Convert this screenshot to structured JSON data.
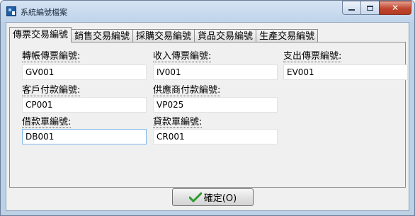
{
  "window": {
    "title": "系統編號檔案"
  },
  "tabs": [
    {
      "label": "傳票交易編號",
      "active": true
    },
    {
      "label": "銷售交易編號",
      "active": false
    },
    {
      "label": "採購交易編號",
      "active": false
    },
    {
      "label": "貨品交易編號",
      "active": false
    },
    {
      "label": "生產交易編號",
      "active": false
    }
  ],
  "fields": {
    "transfer_voucher": {
      "label": "轉帳傳票編號:",
      "value": "GV001"
    },
    "income_voucher": {
      "label": "收入傳票編號:",
      "value": "IV001"
    },
    "expense_voucher": {
      "label": "支出傳票編號:",
      "value": "EV001"
    },
    "customer_payment": {
      "label": "客戶付款編號:",
      "value": "CP001"
    },
    "supplier_payment": {
      "label": "供應商付款編號:",
      "value": "VP025"
    },
    "debit_note": {
      "label": "借款單編號:",
      "value": "DB001"
    },
    "credit_note": {
      "label": "貸款單編號:",
      "value": "CR001"
    }
  },
  "ok_button": {
    "label": "確定(O)"
  },
  "icons": {
    "app": "app-icon",
    "ok": "check-icon"
  },
  "colors": {
    "check": "#2e9a2e",
    "close_button": "#c0462f"
  }
}
